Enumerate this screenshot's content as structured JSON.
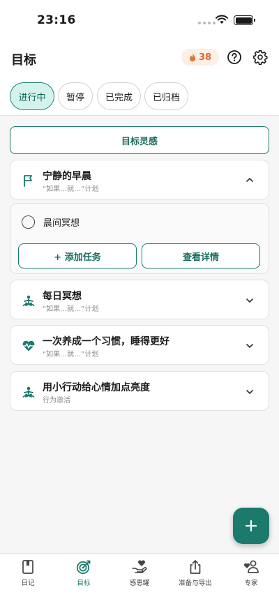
{
  "status_bar": {
    "time": "23:16"
  },
  "header": {
    "title": "目标",
    "streak_count": "38"
  },
  "tabs": [
    {
      "label": "进行中",
      "active": true
    },
    {
      "label": "暂停",
      "active": false
    },
    {
      "label": "已完成",
      "active": false
    },
    {
      "label": "已归档",
      "active": false
    }
  ],
  "inspiration_button": "目标灵感",
  "goals": [
    {
      "title": "宁静的早晨",
      "subtitle": "“如果…就…”计划",
      "icon": "flag-icon",
      "expanded": true
    },
    {
      "title": "每日冥想",
      "subtitle": "“如果…就…”计划",
      "icon": "meditation-icon",
      "expanded": false
    },
    {
      "title": "一次养成一个习惯，睡得更好",
      "subtitle": "“如果…就…”计划",
      "icon": "heartbeat-icon",
      "expanded": false
    },
    {
      "title": "用小行动给心情加点亮度",
      "subtitle": "行为激活",
      "icon": "meditation-icon",
      "expanded": false
    }
  ],
  "expanded_panel": {
    "task_label": "晨间冥想",
    "add_task_label": "+ 添加任务",
    "view_details_label": "查看详情"
  },
  "nav": [
    {
      "label": "日记",
      "icon": "journal-icon",
      "active": false
    },
    {
      "label": "目标",
      "icon": "target-icon",
      "active": true
    },
    {
      "label": "感恩罐",
      "icon": "gratitude-icon",
      "active": false
    },
    {
      "label": "准备与导出",
      "icon": "export-icon",
      "active": false
    },
    {
      "label": "专家",
      "icon": "expert-icon",
      "active": false
    }
  ],
  "colors": {
    "accent": "#1b7a6c",
    "active_tab_bg": "#d4f3ec",
    "streak": "#d86a2b"
  }
}
